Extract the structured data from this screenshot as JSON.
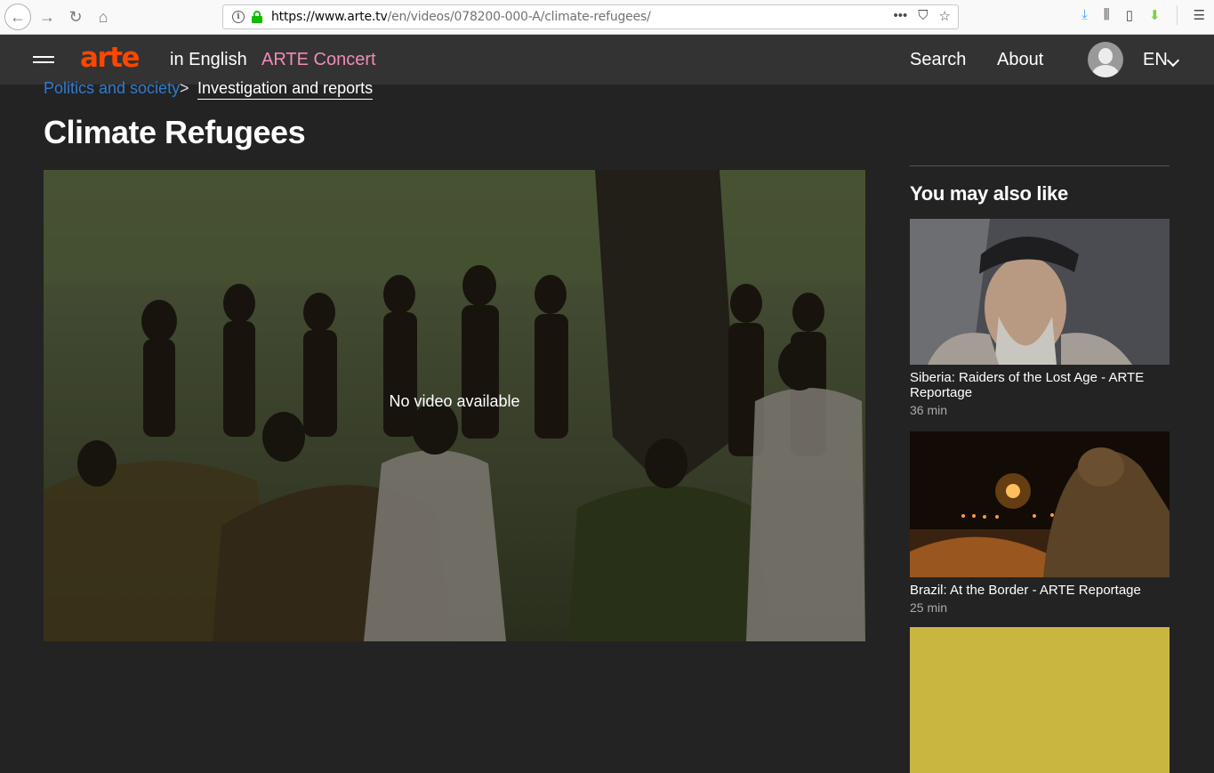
{
  "browser": {
    "url_host": "https://www.arte.tv",
    "url_path": "/en/videos/078200-000-A/climate-refugees/",
    "url_actions": [
      "•••",
      "⛉",
      "☆"
    ]
  },
  "header": {
    "logo": "arte",
    "lang_label": "in English",
    "concert": "ARTE Concert",
    "search": "Search",
    "about": "About",
    "language": "EN",
    "colors": {
      "logo": "#fd4600",
      "concert": "#f28ab8",
      "header_bg": "#333333"
    }
  },
  "breadcrumb": {
    "parent": "Politics and society",
    "separator": ">",
    "current": "Investigation and reports"
  },
  "page": {
    "title": "Climate Refugees",
    "player_message": "No video available"
  },
  "sidebar": {
    "heading": "You may also like",
    "cards": [
      {
        "title": "Siberia: Raiders of the Lost Age - ARTE Reportage",
        "duration": "36 min"
      },
      {
        "title": "Brazil: At the Border - ARTE Reportage",
        "duration": "25 min"
      }
    ]
  }
}
